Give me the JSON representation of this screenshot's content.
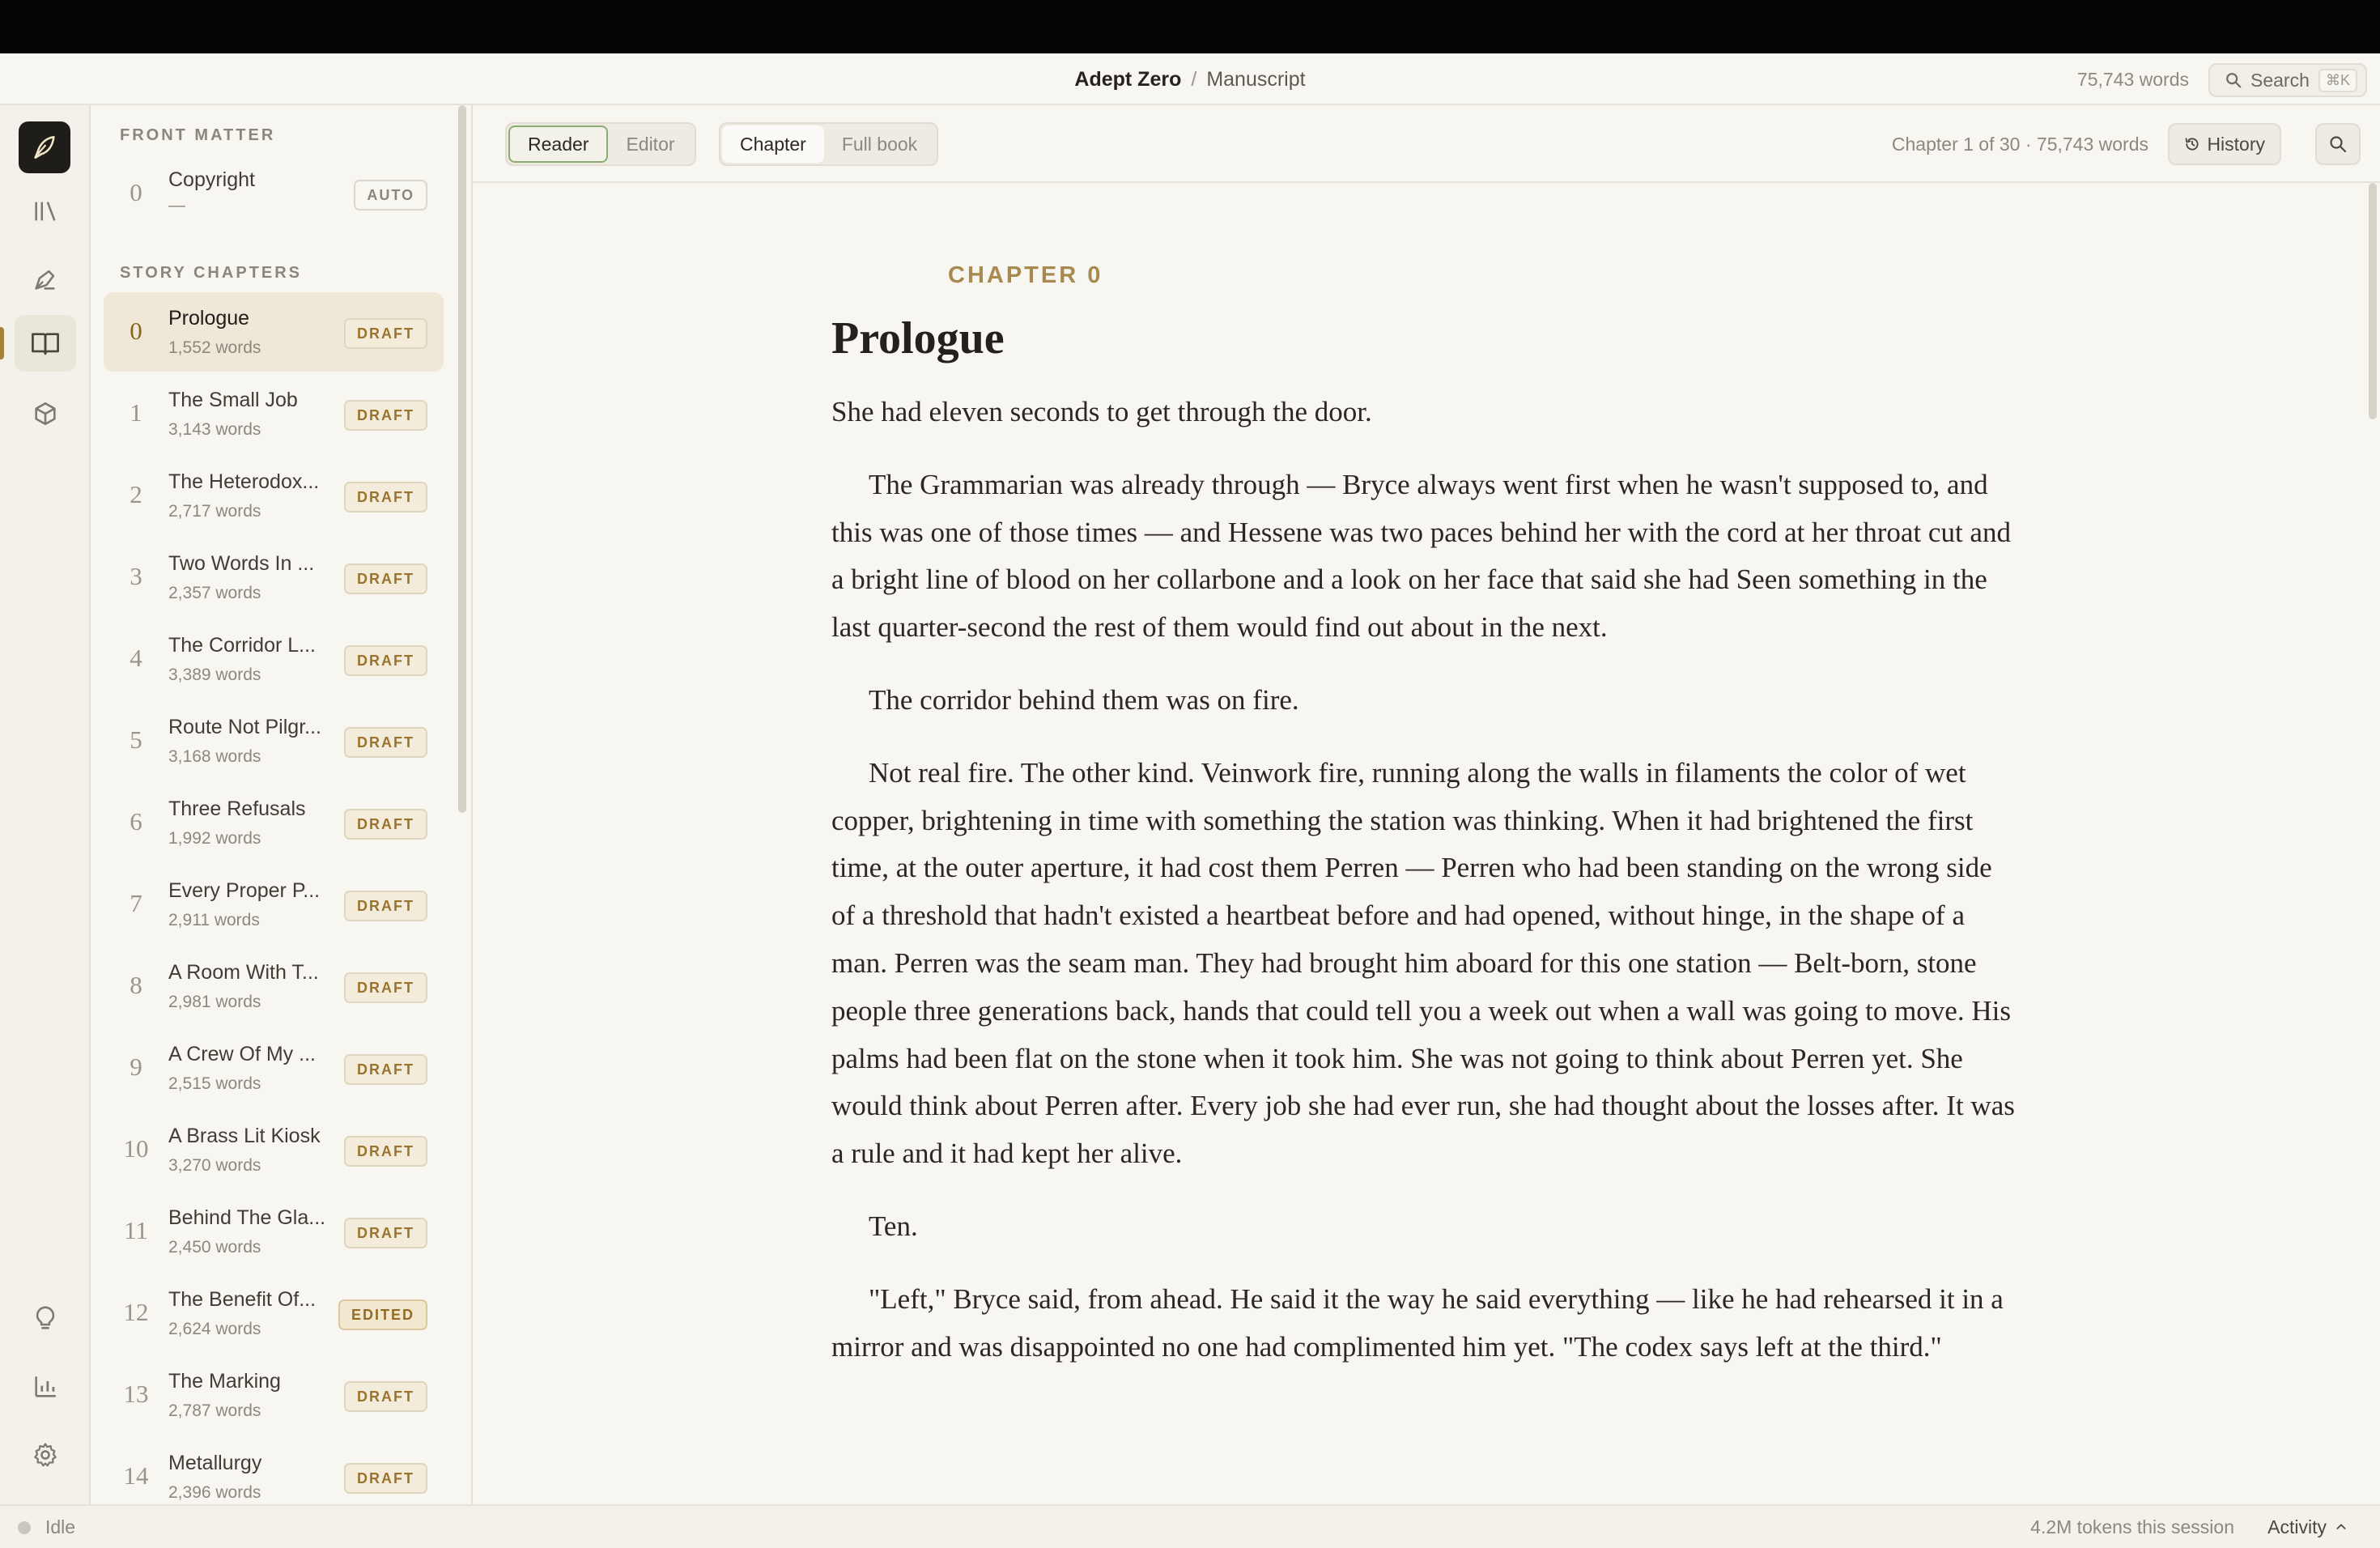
{
  "titlebar": {
    "app_name": "Adept Zero",
    "separator": "/",
    "doc_name": "Manuscript",
    "word_count": "75,743 words",
    "search_label": "Search",
    "search_shortcut": "⌘K"
  },
  "sidebar": {
    "front_matter_label": "FRONT MATTER",
    "front_matter": [
      {
        "num": "0",
        "title": "Copyright",
        "words": "—",
        "badge": "AUTO"
      }
    ],
    "story_label": "STORY CHAPTERS",
    "chapters": [
      {
        "num": "0",
        "title": "Prologue",
        "words": "1,552 words",
        "badge": "DRAFT"
      },
      {
        "num": "1",
        "title": "The Small Job",
        "words": "3,143 words",
        "badge": "DRAFT"
      },
      {
        "num": "2",
        "title": "The Heterodox...",
        "words": "2,717 words",
        "badge": "DRAFT"
      },
      {
        "num": "3",
        "title": "Two Words In ...",
        "words": "2,357 words",
        "badge": "DRAFT"
      },
      {
        "num": "4",
        "title": "The Corridor L...",
        "words": "3,389 words",
        "badge": "DRAFT"
      },
      {
        "num": "5",
        "title": "Route Not Pilgr...",
        "words": "3,168 words",
        "badge": "DRAFT"
      },
      {
        "num": "6",
        "title": "Three Refusals",
        "words": "1,992 words",
        "badge": "DRAFT"
      },
      {
        "num": "7",
        "title": "Every Proper P...",
        "words": "2,911 words",
        "badge": "DRAFT"
      },
      {
        "num": "8",
        "title": "A Room With T...",
        "words": "2,981 words",
        "badge": "DRAFT"
      },
      {
        "num": "9",
        "title": "A Crew Of My ...",
        "words": "2,515 words",
        "badge": "DRAFT"
      },
      {
        "num": "10",
        "title": "A Brass Lit Kiosk",
        "words": "3,270 words",
        "badge": "DRAFT"
      },
      {
        "num": "11",
        "title": "Behind The Gla...",
        "words": "2,450 words",
        "badge": "DRAFT"
      },
      {
        "num": "12",
        "title": "The Benefit Of...",
        "words": "2,624 words",
        "badge": "EDITED"
      },
      {
        "num": "13",
        "title": "The Marking",
        "words": "2,787 words",
        "badge": "DRAFT"
      },
      {
        "num": "14",
        "title": "Metallurgy",
        "words": "2,396 words",
        "badge": "DRAFT"
      }
    ]
  },
  "toolbar": {
    "mode_reader": "Reader",
    "mode_editor": "Editor",
    "scope_chapter": "Chapter",
    "scope_full_book": "Full book",
    "meta": "Chapter 1 of 30 · 75,743 words",
    "history_label": "History"
  },
  "reader": {
    "kicker": "CHAPTER 0",
    "heading": "Prologue",
    "paragraphs": [
      "She had eleven seconds to get through the door.",
      "The Grammarian was already through — Bryce always went first when he wasn't supposed to, and this was one of those times — and Hessene was two paces behind her with the cord at her throat cut and a bright line of blood on her collarbone and a look on her face that said she had Seen something in the last quarter-second the rest of them would find out about in the next.",
      "The corridor behind them was on fire.",
      "Not real fire. The other kind. Veinwork fire, running along the walls in filaments the color of wet copper, brightening in time with something the station was thinking. When it had brightened the first time, at the outer aperture, it had cost them Perren — Perren who had been standing on the wrong side of a threshold that hadn't existed a heartbeat before and had opened, without hinge, in the shape of a man. Perren was the seam man. They had brought him aboard for this one station — Belt-born, stone people three generations back, hands that could tell you a week out when a wall was going to move. His palms had been flat on the stone when it took him. She was not going to think about Perren yet. She would think about Perren after. Every job she had ever run, she had thought about the losses after. It was a rule and it had kept her alive.",
      "Ten.",
      "\"Left,\" Bryce said, from ahead. He said it the way he said everything — like he had rehearsed it in a mirror and was disappointed no one had complimented him yet. \"The codex says left at the third.\""
    ]
  },
  "statusbar": {
    "state": "Idle",
    "tokens": "4.2M tokens this session",
    "activity_label": "Activity"
  },
  "colors": {
    "accent": "#a4823c",
    "background": "#f8f6f1",
    "draft_badge": "#9a742c",
    "reader_active": "#8bab73"
  }
}
